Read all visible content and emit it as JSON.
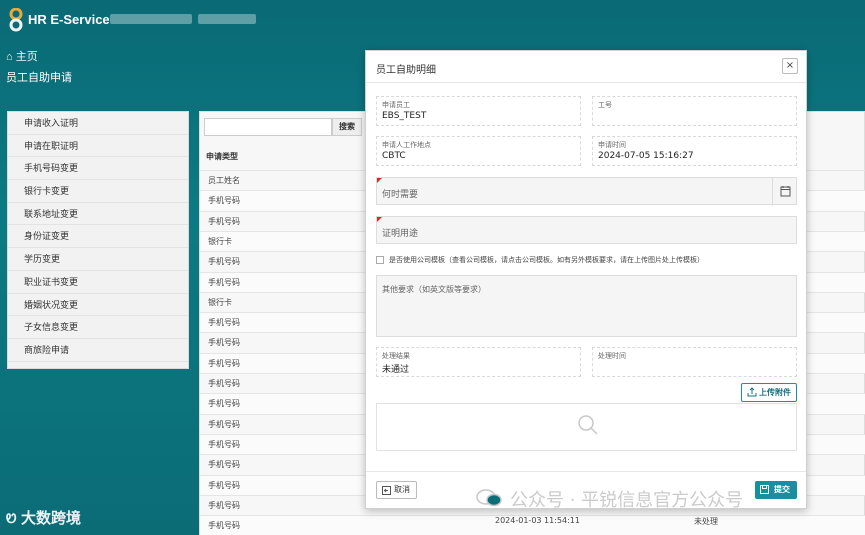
{
  "header": {
    "app_title": "HR E-Service"
  },
  "breadcrumb": {
    "home": "主页"
  },
  "page_title": "员工自助申请",
  "sidebar": {
    "items": [
      {
        "label": "申请收入证明"
      },
      {
        "label": "申请在职证明"
      },
      {
        "label": "手机号码变更"
      },
      {
        "label": "银行卡变更"
      },
      {
        "label": "联系地址变更"
      },
      {
        "label": "身份证变更"
      },
      {
        "label": "学历变更"
      },
      {
        "label": "职业证书变更"
      },
      {
        "label": "婚姻状况变更"
      },
      {
        "label": "子女信息变更"
      },
      {
        "label": "商旅险申请"
      }
    ]
  },
  "table": {
    "search_button": "搜索",
    "column_header": "申请类型",
    "rows": [
      "员工姓名",
      "手机号码",
      "手机号码",
      "银行卡",
      "手机号码",
      "手机号码",
      "银行卡",
      "手机号码",
      "手机号码",
      "手机号码",
      "手机号码",
      "手机号码",
      "手机号码",
      "手机号码",
      "手机号码",
      "手机号码",
      "手机号码",
      "手机号码"
    ],
    "last_row": {
      "type": "手机号码",
      "time": "2024-01-03 11:54:11",
      "status": "未处理"
    }
  },
  "modal": {
    "title": "员工自助明细",
    "close": "×",
    "fields": {
      "applicant": {
        "label": "申请员工",
        "value": "EBS_TEST"
      },
      "employee_no": {
        "label": "工号",
        "value": ""
      },
      "workplace": {
        "label": "申请人工作地点",
        "value": "CBTC"
      },
      "apply_time": {
        "label": "申请时间",
        "value": "2024-07-05 15:16:27"
      },
      "when_needed": {
        "placeholder": "何时需要"
      },
      "purpose": {
        "placeholder": "证明用途"
      },
      "use_template": {
        "label": "是否使用公司模板（查看公司模板，请点击公司模板。如有另外模板要求，请在上传图片处上传模板）"
      },
      "other_requirements": {
        "placeholder": "其他要求（如英文版等要求）"
      },
      "result": {
        "label": "处理结果",
        "value": "未通过"
      },
      "process_time": {
        "label": "处理时间",
        "value": ""
      }
    },
    "upload_button": "上传附件",
    "cancel_button": "取消",
    "submit_button": "提交"
  },
  "watermarks": {
    "left": "大数跨境",
    "right": "公众号 · 平锐信息官方公众号"
  },
  "colors": {
    "background": "#0b6f7a",
    "accent": "#1a8ea1",
    "required_marker": "#d62a2a"
  }
}
